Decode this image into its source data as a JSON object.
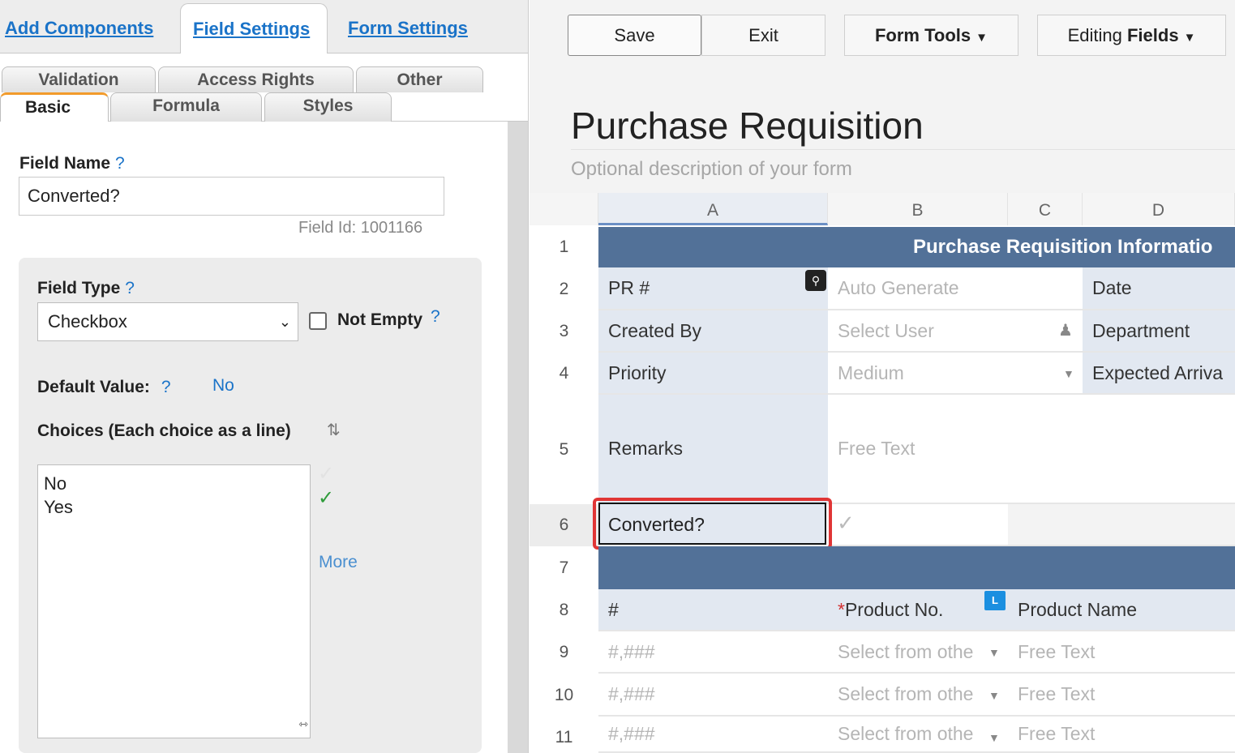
{
  "left_panel": {
    "top_tabs": [
      "Add Components",
      "Field Settings",
      "Form Settings"
    ],
    "sub_tabs_row1": [
      "Validation",
      "Access Rights",
      "Other"
    ],
    "sub_tabs_row2": [
      "Basic",
      "Formula",
      "Styles"
    ],
    "field_name_label": "Field Name",
    "help_mark": "?",
    "field_name_value": "Converted?",
    "field_id": "Field Id:  1001166",
    "field_type_label": "Field Type",
    "field_type_value": "Checkbox",
    "not_empty_label": "Not Empty",
    "default_value_label": "Default Value:",
    "default_value": "No",
    "choices_label": "Choices (Each choice as a line)",
    "choices": [
      "No",
      "Yes"
    ],
    "more_label": "More"
  },
  "toolbar": {
    "save": "Save",
    "exit": "Exit",
    "form_tools": "Form Tools",
    "editing_prefix": "Editing",
    "editing_bold": "Fields"
  },
  "form": {
    "title": "Purchase Requisition",
    "description": "Optional description of your form"
  },
  "grid": {
    "columns": [
      "A",
      "B",
      "C",
      "D"
    ],
    "rows": [
      "1",
      "2",
      "3",
      "4",
      "5",
      "6",
      "7",
      "8",
      "9",
      "10",
      "11"
    ],
    "section_title": "Purchase Requisition Informatio",
    "r2": {
      "a": "PR #",
      "b": "Auto Generate",
      "d": "Date"
    },
    "r3": {
      "a": "Created By",
      "b": "Select User",
      "d": "Department"
    },
    "r4": {
      "a": "Priority",
      "b": "Medium",
      "d": "Expected Arriva"
    },
    "r5": {
      "a": "Remarks",
      "b": "Free Text"
    },
    "r6": {
      "a": "Converted?"
    },
    "r8": {
      "a": "#",
      "b_req": "*",
      "b": "Product No.",
      "c": "Product Name",
      "badge": "L"
    },
    "r9": {
      "a": "#,###",
      "b": "Select from othe",
      "c": "Free Text"
    },
    "r10": {
      "a": "#,###",
      "b": "Select from othe",
      "c": "Free Text"
    },
    "r11": {
      "a": "#,###",
      "b": "Select from othe",
      "c": "Free Text"
    }
  }
}
